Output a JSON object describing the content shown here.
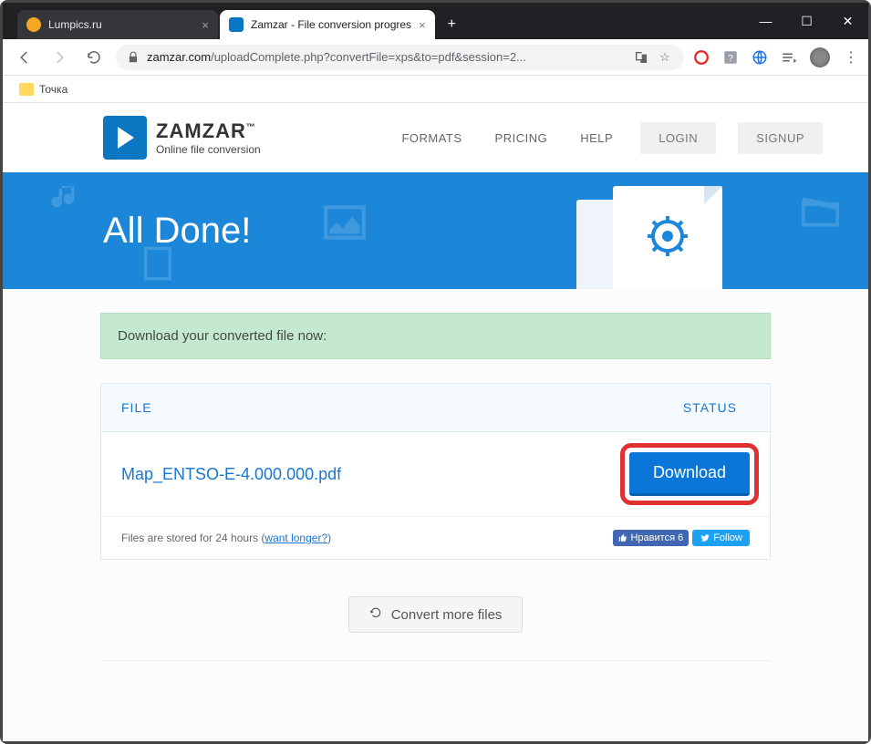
{
  "browser": {
    "tabs": [
      {
        "title": "Lumpics.ru",
        "active": false
      },
      {
        "title": "Zamzar - File conversion progres",
        "active": true
      }
    ],
    "url_domain": "zamzar.com",
    "url_path": "/uploadComplete.php?convertFile=xps&to=pdf&session=2...",
    "bookmark_label": "Точка"
  },
  "header": {
    "logo_title": "ZAMZAR",
    "logo_tm": "™",
    "logo_subtitle": "Online file conversion",
    "nav": {
      "formats": "FORMATS",
      "pricing": "PRICING",
      "help": "HELP",
      "login": "LOGIN",
      "signup": "SIGNUP"
    }
  },
  "hero": {
    "title": "All Done!"
  },
  "alert": {
    "message": "Download your converted file now:"
  },
  "table": {
    "col_file": "FILE",
    "col_status": "STATUS",
    "file_name": "Map_ENTSO-E-4.000.000.pdf",
    "download_label": "Download",
    "storage_notice_prefix": "Files are stored for 24 hours (",
    "storage_notice_link": "want longer?",
    "storage_notice_suffix": ")",
    "fb_like": "Нравится 6",
    "tw_follow": "Follow"
  },
  "convert_more_label": "Convert more files"
}
